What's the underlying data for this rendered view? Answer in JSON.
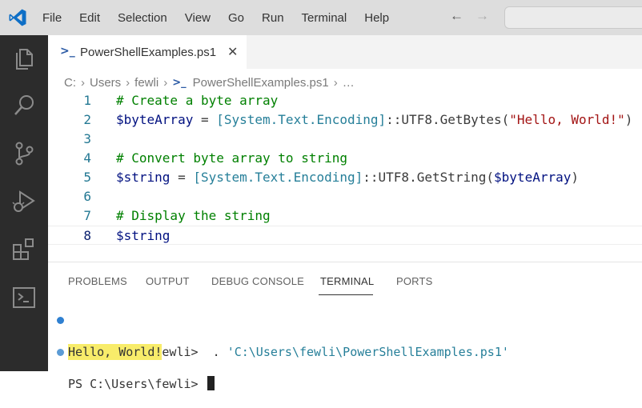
{
  "menu": [
    "File",
    "Edit",
    "Selection",
    "View",
    "Go",
    "Run",
    "Terminal",
    "Help"
  ],
  "nav": {
    "back_icon": "←",
    "forward_icon": "→"
  },
  "tab": {
    "label": "PowerShellExamples.ps1",
    "close": "✕",
    "icon": "powershell-icon"
  },
  "breadcrumb": {
    "drive": "C:",
    "users": "Users",
    "user": "fewli",
    "file": "PowerShellExamples.ps1",
    "more": "…",
    "sep": "›"
  },
  "editor": {
    "lines": [
      {
        "n": "1",
        "parts": [
          {
            "t": "# Create a byte array",
            "c": "comment"
          }
        ]
      },
      {
        "n": "2",
        "parts": [
          {
            "t": "$byteArray",
            "c": "var"
          },
          {
            "t": " = ",
            "c": "default"
          },
          {
            "t": "[System.Text.Encoding]",
            "c": "type"
          },
          {
            "t": "::UTF8.GetBytes(",
            "c": "default"
          },
          {
            "t": "\"Hello, World!\"",
            "c": "str"
          },
          {
            "t": ")",
            "c": "default"
          }
        ]
      },
      {
        "n": "3",
        "parts": []
      },
      {
        "n": "4",
        "parts": [
          {
            "t": "# Convert byte array to string",
            "c": "comment"
          }
        ]
      },
      {
        "n": "5",
        "parts": [
          {
            "t": "$string",
            "c": "var"
          },
          {
            "t": " = ",
            "c": "default"
          },
          {
            "t": "[System.Text.Encoding]",
            "c": "type"
          },
          {
            "t": "::UTF8.GetString(",
            "c": "default"
          },
          {
            "t": "$byteArray",
            "c": "var"
          },
          {
            "t": ")",
            "c": "default"
          }
        ]
      },
      {
        "n": "6",
        "parts": []
      },
      {
        "n": "7",
        "parts": [
          {
            "t": "# Display the string",
            "c": "comment"
          }
        ]
      },
      {
        "n": "8",
        "parts": [
          {
            "t": "$string",
            "c": "var"
          }
        ],
        "active": true
      }
    ]
  },
  "panel": {
    "tabs": [
      "PROBLEMS",
      "OUTPUT",
      "DEBUG CONSOLE",
      "TERMINAL",
      "PORTS"
    ],
    "active_tab": "TERMINAL"
  },
  "terminal": {
    "line1": {
      "prompt": "PS C:\\Users\\fewli> ",
      "dot": " . ",
      "arg": "'C:\\Users\\fewli\\PowerShellExamples.ps1'"
    },
    "line2": {
      "output": "Hello, World!"
    },
    "line3": {
      "prompt": "PS C:\\Users\\fewli> "
    }
  },
  "colors": {
    "accent_blue": "#0078d4",
    "dot_success": "#2f80d1",
    "dot_plain": "#5b9bd5",
    "activity_bar": "#2c2c2c",
    "output_highlight": "#f8ec6a"
  }
}
